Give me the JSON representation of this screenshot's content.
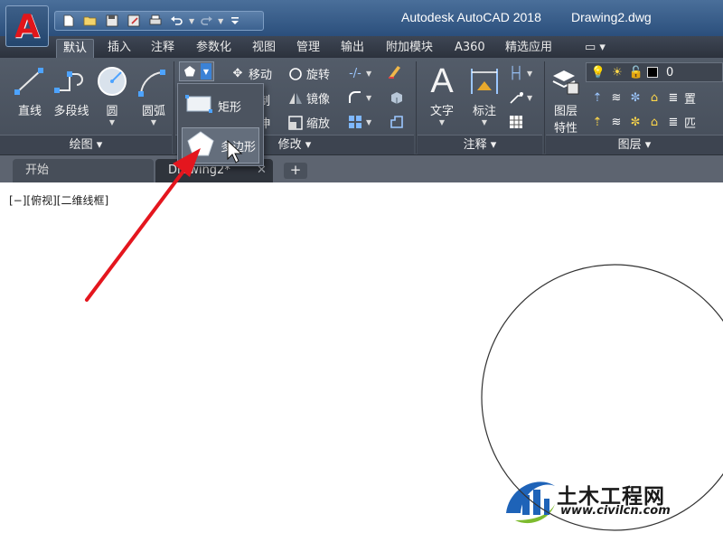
{
  "app": {
    "logo_letter": "A",
    "title": "Autodesk AutoCAD 2018",
    "document": "Drawing2.dwg"
  },
  "ribbon_tabs": [
    "默认",
    "插入",
    "注释",
    "参数化",
    "视图",
    "管理",
    "输出",
    "附加模块",
    "A360",
    "精选应用"
  ],
  "draw_panel": {
    "line": "直线",
    "polyline": "多段线",
    "circle": "圆",
    "arc": "圆弧",
    "footer": "绘图"
  },
  "modify_panel": {
    "move": "移动",
    "rotate": "旋转",
    "mirror": "镜像",
    "scale": "缩放",
    "copy_fragment": "制",
    "stretch_fragment": "伸",
    "footer": "修改"
  },
  "annotation_panel": {
    "text": "文字",
    "dimension": "标注",
    "footer": "注释"
  },
  "layers_panel": {
    "properties_line1": "图层",
    "properties_line2": "特性",
    "current_layer": "0",
    "footer": "图层",
    "cut_off_1": "置",
    "cut_off_2": "匹"
  },
  "dropdown": {
    "rectangle": "矩形",
    "polygon": "多边形"
  },
  "file_tabs": {
    "start": "开始",
    "drawing": "Drawing2*"
  },
  "viewport_label": "[−][俯视][二维线框]",
  "watermark": {
    "name": "土木工程网",
    "url": "www.civilcn.com"
  },
  "colors": {
    "autocad_red": "#e1161b",
    "ribbon": "#4c5460",
    "annotation_arrow": "#e4161e"
  }
}
